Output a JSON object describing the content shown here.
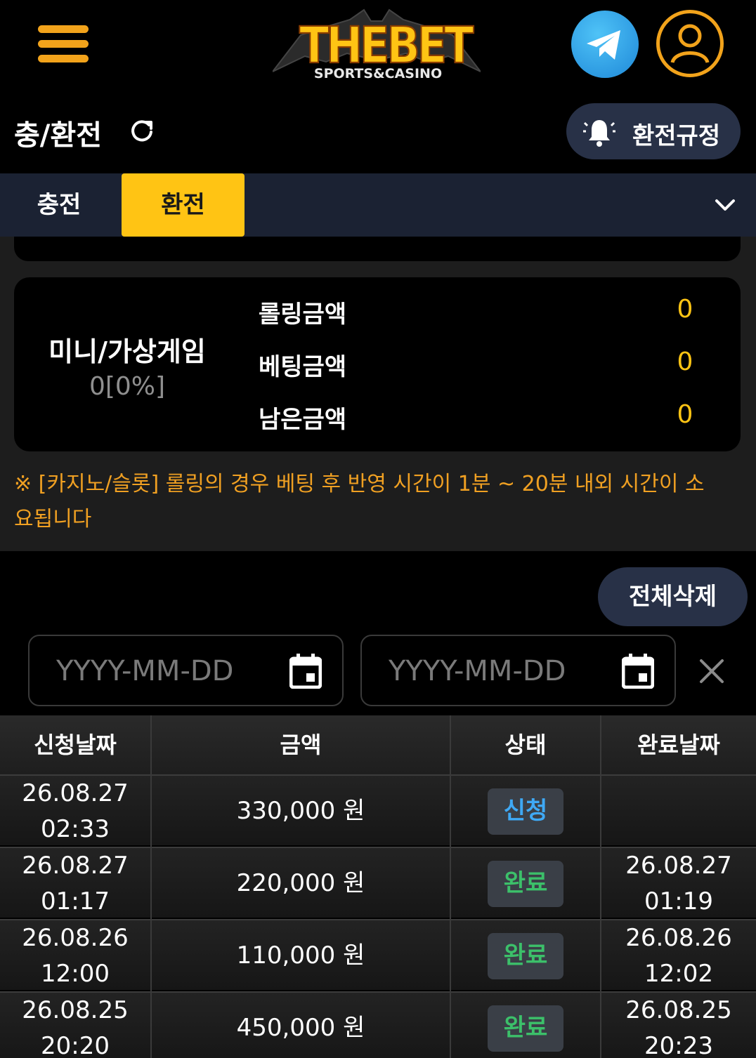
{
  "header": {
    "logo_text": "THEBET",
    "logo_sub": "SPORTS&CASINO"
  },
  "page": {
    "title": "충/환전",
    "rules_label": "환전규정"
  },
  "tabs": [
    {
      "label": "충전",
      "active": false
    },
    {
      "label": "환전",
      "active": true
    }
  ],
  "rolling": {
    "game_name": "미니/가상게임",
    "game_percent": "0[0%]",
    "items": [
      {
        "label": "롤링금액",
        "value": "0"
      },
      {
        "label": "베팅금액",
        "value": "0"
      },
      {
        "label": "남은금액",
        "value": "0"
      }
    ]
  },
  "notice": {
    "line1": "※ [카지노/슬롯] 롤링의 경우 베팅 후 반영 시간이 1분 ~ 20분 내외 시간이 소",
    "line2": "요됩니다"
  },
  "actions": {
    "delete_all": "전체삭제"
  },
  "filters": {
    "start_placeholder": "YYYY-MM-DD",
    "end_placeholder": "YYYY-MM-DD"
  },
  "table": {
    "headers": [
      "신청날짜",
      "금액",
      "상태",
      "완료날짜"
    ],
    "rows": [
      {
        "req_date": "26.08.27",
        "req_time": "02:33",
        "amount": "330,000 원",
        "status": "신청",
        "status_type": "pending",
        "done_date": "",
        "done_time": ""
      },
      {
        "req_date": "26.08.27",
        "req_time": "01:17",
        "amount": "220,000 원",
        "status": "완료",
        "status_type": "done",
        "done_date": "26.08.27",
        "done_time": "01:19"
      },
      {
        "req_date": "26.08.26",
        "req_time": "12:00",
        "amount": "110,000 원",
        "status": "완료",
        "status_type": "done",
        "done_date": "26.08.26",
        "done_time": "12:02"
      },
      {
        "req_date": "26.08.25",
        "req_time": "20:20",
        "amount": "450,000 원",
        "status": "완료",
        "status_type": "done",
        "done_date": "26.08.25",
        "done_time": "20:23"
      }
    ]
  },
  "colors": {
    "accent": "#ffc414",
    "nav_bg": "#1b2233",
    "pending": "#3fa9f5",
    "done": "#3cc06a"
  }
}
